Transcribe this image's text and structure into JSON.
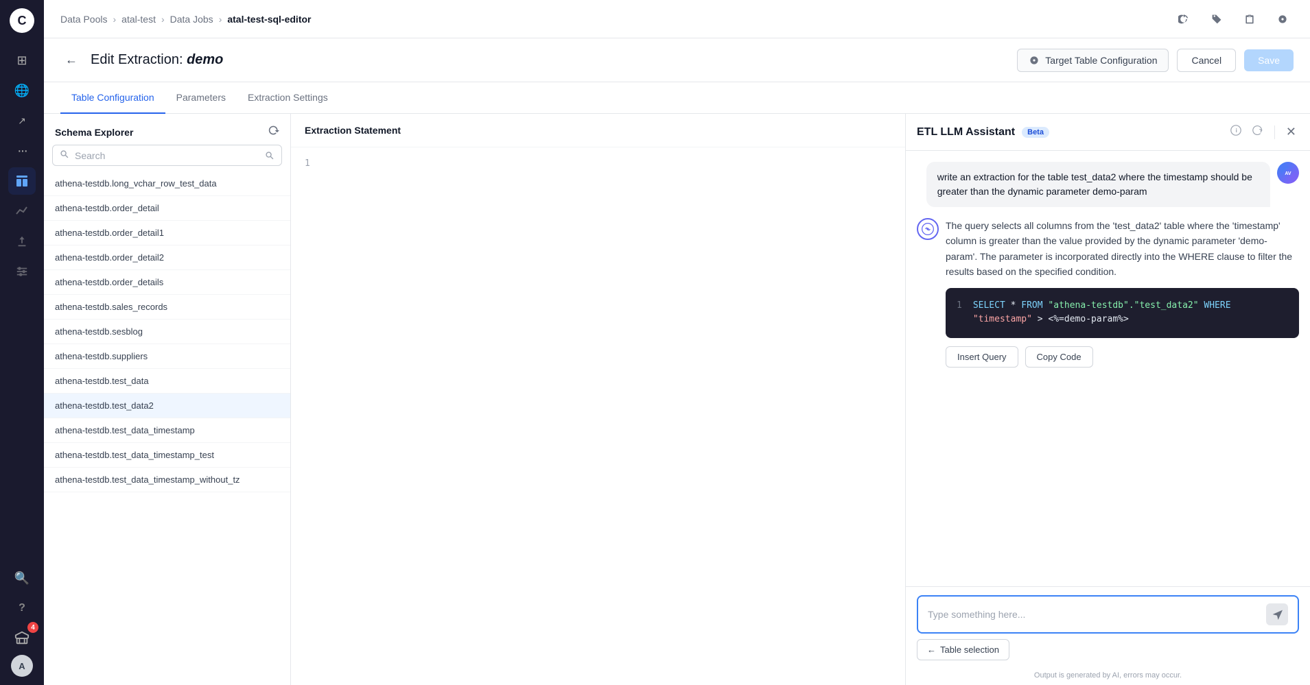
{
  "sidebar": {
    "logo": "C",
    "nav_items": [
      {
        "id": "grid",
        "icon": "⊞",
        "active": false
      },
      {
        "id": "globe",
        "icon": "🌐",
        "active": false
      },
      {
        "id": "graph",
        "icon": "↗",
        "active": false
      },
      {
        "id": "more",
        "icon": "···",
        "active": false
      },
      {
        "id": "table",
        "icon": "▦",
        "active": true
      },
      {
        "id": "chart",
        "icon": "📈",
        "active": false
      },
      {
        "id": "upload",
        "icon": "⬆",
        "active": false
      },
      {
        "id": "sliders",
        "icon": "⚙",
        "active": false
      },
      {
        "id": "search",
        "icon": "🔍",
        "active": false
      },
      {
        "id": "help",
        "icon": "?",
        "active": false
      },
      {
        "id": "notification",
        "icon": "🎓",
        "badge": "4",
        "active": false
      },
      {
        "id": "user",
        "icon": "A",
        "active": false
      }
    ]
  },
  "breadcrumb": {
    "items": [
      "Data Pools",
      "atal-test",
      "Data Jobs",
      "atal-test-sql-editor"
    ],
    "current_index": 3
  },
  "breadcrumb_icons": [
    "🔄",
    "🏷",
    "📋",
    "⚙"
  ],
  "page": {
    "back_label": "←",
    "title_prefix": "Edit Extraction: ",
    "title_italic": "demo"
  },
  "buttons": {
    "target_config": "Target Table Configuration",
    "cancel": "Cancel",
    "save": "Save"
  },
  "tabs": [
    {
      "id": "table-config",
      "label": "Table Configuration",
      "active": true
    },
    {
      "id": "parameters",
      "label": "Parameters",
      "active": false
    },
    {
      "id": "extraction-settings",
      "label": "Extraction Settings",
      "active": false
    }
  ],
  "schema_explorer": {
    "title": "Schema Explorer",
    "search_placeholder": "Search",
    "items": [
      {
        "id": 1,
        "label": "athena-testdb.long_vchar_row_test_data"
      },
      {
        "id": 2,
        "label": "athena-testdb.order_detail"
      },
      {
        "id": 3,
        "label": "athena-testdb.order_detail1"
      },
      {
        "id": 4,
        "label": "athena-testdb.order_detail2"
      },
      {
        "id": 5,
        "label": "athena-testdb.order_details"
      },
      {
        "id": 6,
        "label": "athena-testdb.sales_records"
      },
      {
        "id": 7,
        "label": "athena-testdb.sesblog"
      },
      {
        "id": 8,
        "label": "athena-testdb.suppliers"
      },
      {
        "id": 9,
        "label": "athena-testdb.test_data"
      },
      {
        "id": 10,
        "label": "athena-testdb.test_data2",
        "highlighted": true
      },
      {
        "id": 11,
        "label": "athena-testdb.test_data_timestamp"
      },
      {
        "id": 12,
        "label": "athena-testdb.test_data_timestamp_test"
      },
      {
        "id": 13,
        "label": "athena-testdb.test_data_timestamp_without_tz"
      }
    ]
  },
  "extraction": {
    "title": "Extraction Statement",
    "line_numbers": [
      "1"
    ],
    "content": ""
  },
  "assistant": {
    "title": "ETL LLM Assistant",
    "badge": "Beta",
    "user_message": "write an extraction for the table test_data2 where the timestamp should be greater than the dynamic parameter demo-param",
    "ai_response": "The query selects all columns from the 'test_data2' table where the 'timestamp' column is greater than the value provided by the dynamic parameter 'demo-param'. The parameter is incorporated directly into the WHERE clause to filter the results based on the specified condition.",
    "code": {
      "line_num": "1",
      "keyword_select": "SELECT",
      "star": " * ",
      "keyword_from": "FROM",
      "table": " \"athena-testdb\".\"test_data2\" ",
      "keyword_where": "WHERE",
      "col": " \"timestamp\"",
      "op": " >",
      "param": " <%=demo-param%>"
    },
    "buttons": {
      "insert_query": "Insert Query",
      "copy_code": "Copy Code"
    },
    "input_placeholder": "Type something here...",
    "table_selection": "Table selection",
    "output_note": "Output is generated by AI, errors may occur."
  }
}
